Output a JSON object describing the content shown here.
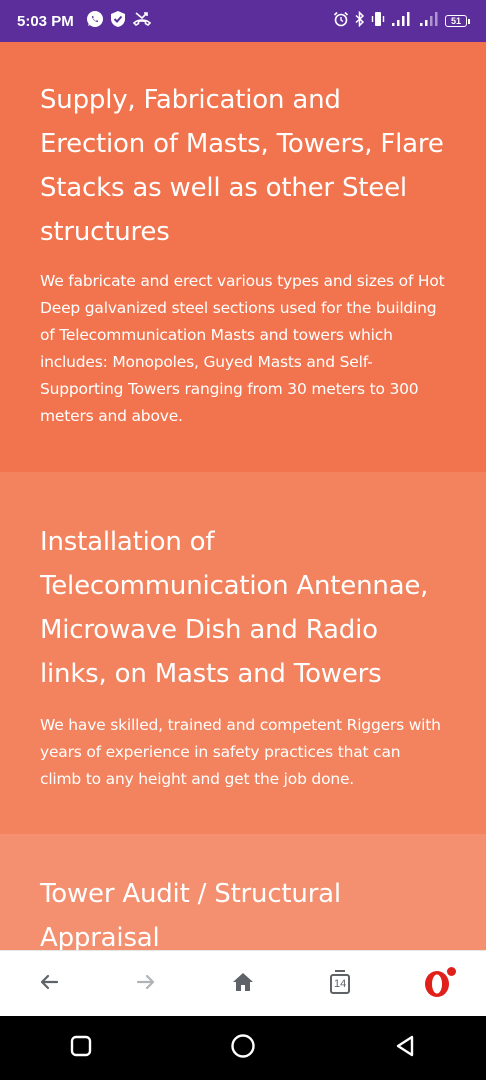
{
  "status_bar": {
    "time": "5:03 PM",
    "battery_level": "51",
    "left_icons": [
      "whatsapp-icon",
      "shield-check-icon",
      "missed-call-icon"
    ],
    "right_icons": [
      "alarm-icon",
      "bluetooth-icon",
      "vibrate-icon",
      "signal-icon",
      "signal-icon-2"
    ]
  },
  "sections": [
    {
      "title": "Supply, Fabrication and Erection of Masts, Towers, Flare Stacks as well as other Steel structures",
      "body": "We fabricate and erect various types and sizes of Hot Deep galvanized steel sections used for the building of Telecommunication Masts and towers which includes: Monopoles, Guyed Masts and Self-Supporting Towers ranging from 30 meters to 300 meters and above.",
      "bg_color": "#f1744e"
    },
    {
      "title": "Installation of Telecommunication Antennae, Microwave Dish and Radio links, on Masts and Towers",
      "body": "We have skilled, trained and competent Riggers with years of experience in safety practices that can climb to any height and get the job done.",
      "bg_color": "#f2835e"
    },
    {
      "title": "Tower Audit / Structural Appraisal",
      "bg_color": "#f4906f"
    }
  ],
  "browser_bar": {
    "tab_count": "14",
    "icons": [
      "back-arrow-icon",
      "forward-arrow-icon",
      "home-icon",
      "tabs-icon",
      "opera-menu-icon"
    ],
    "accent_color": "#e0201b"
  },
  "system_nav": {
    "icons": [
      "recents-icon",
      "home-circle-icon",
      "back-triangle-icon"
    ]
  }
}
